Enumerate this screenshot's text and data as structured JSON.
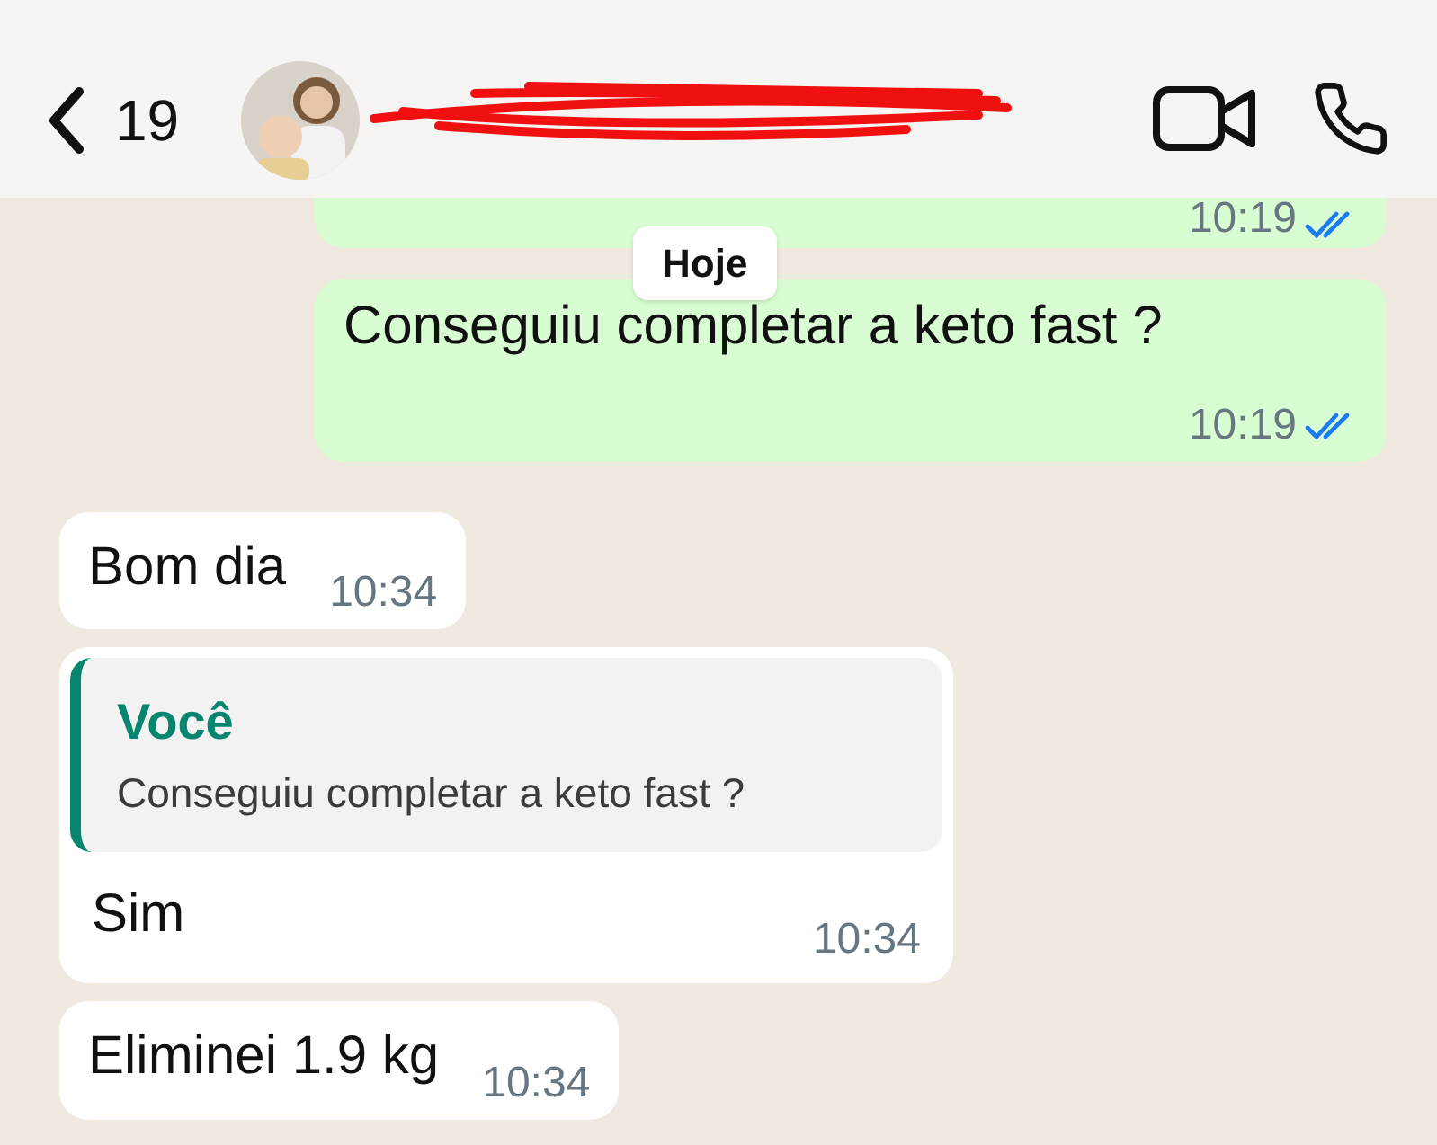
{
  "header": {
    "back_count": "19"
  },
  "date_chip": "Hoje",
  "messages": [
    {
      "kind": "outgoing",
      "time": "10:19",
      "read": true,
      "cut": true
    },
    {
      "kind": "outgoing",
      "text": "Conseguiu completar a keto fast ?",
      "time": "10:19",
      "read": true
    },
    {
      "kind": "incoming",
      "text": "Bom dia",
      "time": "10:34"
    },
    {
      "kind": "incoming",
      "quote": {
        "author": "Você",
        "text": "Conseguiu completar a keto fast ?"
      },
      "text": "Sim",
      "time": "10:34"
    },
    {
      "kind": "incoming",
      "text": "Eliminei 1.9 kg",
      "time": "10:34"
    }
  ]
}
